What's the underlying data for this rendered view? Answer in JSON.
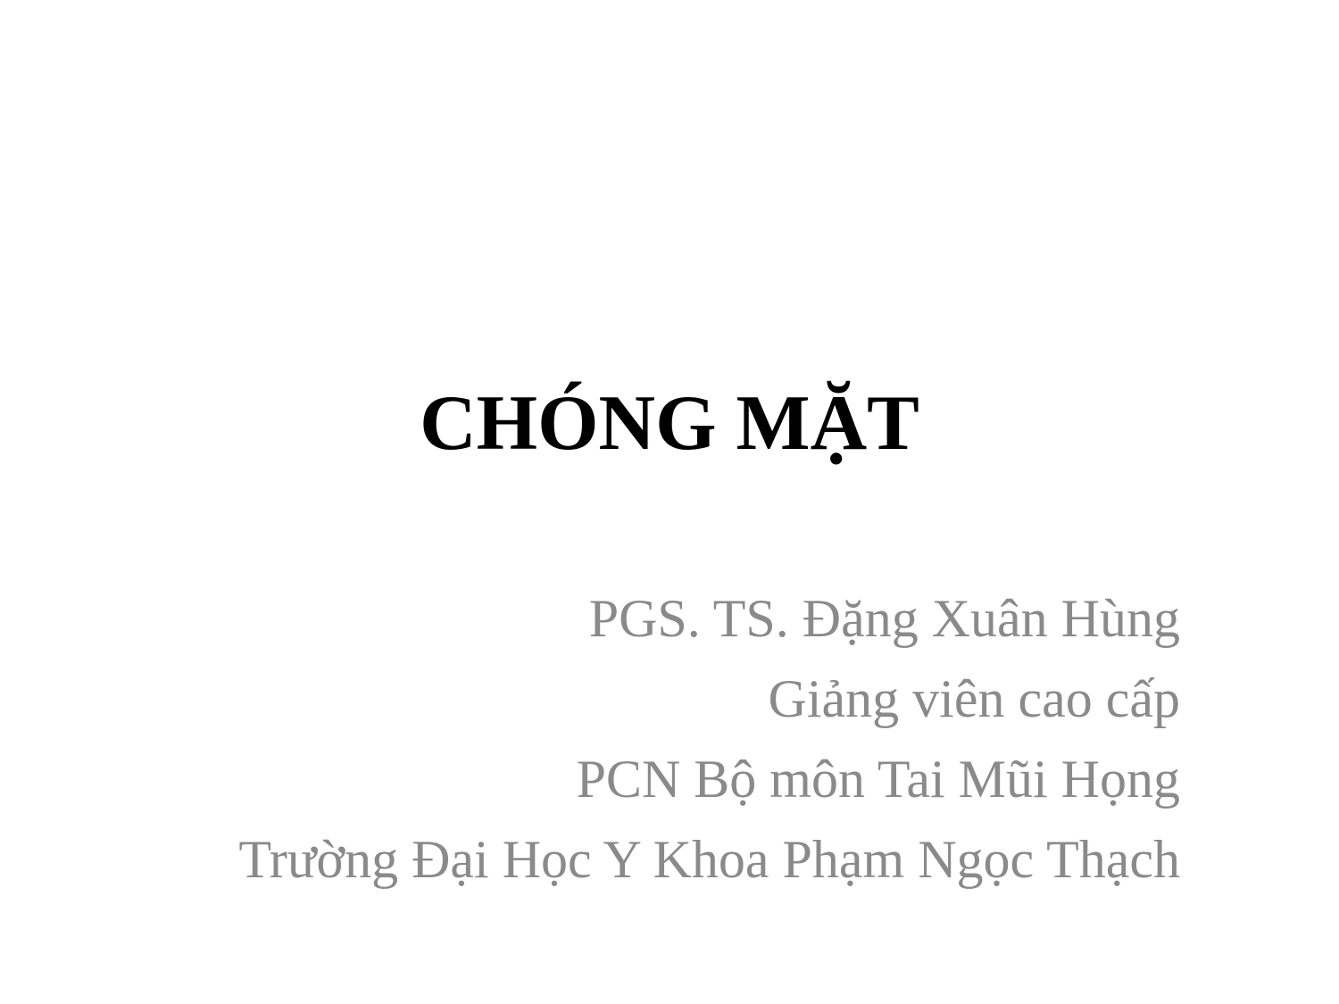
{
  "slide": {
    "title": "CHÓNG MẶT",
    "subtitle_lines": [
      "PGS. TS. Đặng Xuân Hùng",
      "Giảng viên cao cấp",
      "PCN Bộ môn Tai Mũi Họng",
      "Trường Đại Học Y Khoa Phạm Ngọc Thạch"
    ],
    "colors": {
      "title": "#000000",
      "subtitle": "#8a8a8a",
      "background": "#ffffff"
    }
  }
}
